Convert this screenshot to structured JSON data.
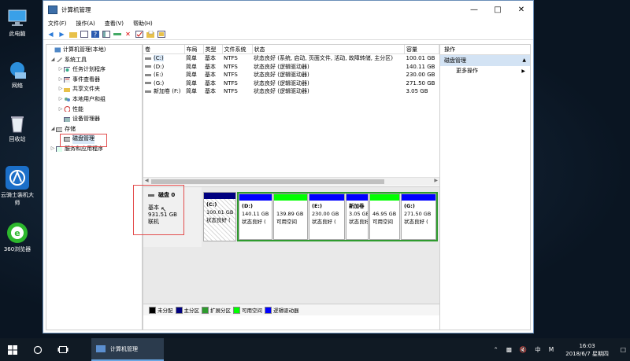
{
  "desktop": {
    "icons": [
      {
        "label": "此电脑"
      },
      {
        "label": "网络"
      },
      {
        "label": "回收站"
      },
      {
        "label": "云骑士装机大师"
      },
      {
        "label": "360浏览器"
      }
    ]
  },
  "window": {
    "title": "计算机管理",
    "menu": [
      "文件(F)",
      "操作(A)",
      "查看(V)",
      "帮助(H)"
    ]
  },
  "tree": {
    "items": [
      {
        "label": "计算机管理(本地)"
      },
      {
        "label": "系统工具"
      },
      {
        "label": "任务计划程序"
      },
      {
        "label": "事件查看器"
      },
      {
        "label": "共享文件夹"
      },
      {
        "label": "本地用户和组"
      },
      {
        "label": "性能"
      },
      {
        "label": "设备管理器"
      },
      {
        "label": "存储"
      },
      {
        "label": "磁盘管理"
      },
      {
        "label": "服务和应用程序"
      }
    ]
  },
  "volumes": {
    "headers": [
      "卷",
      "布局",
      "类型",
      "文件系统",
      "状态",
      "容量"
    ],
    "rows": [
      [
        "(C:)",
        "简单",
        "基本",
        "NTFS",
        "状态良好 (系统, 启动, 页面文件, 活动, 故障转储, 主分区)",
        "100.01 GB"
      ],
      [
        "(D:)",
        "简单",
        "基本",
        "NTFS",
        "状态良好 (逻辑驱动器)",
        "140.11 GB"
      ],
      [
        "(E:)",
        "简单",
        "基本",
        "NTFS",
        "状态良好 (逻辑驱动器)",
        "230.00 GB"
      ],
      [
        "(G:)",
        "简单",
        "基本",
        "NTFS",
        "状态良好 (逻辑驱动器)",
        "271.50 GB"
      ],
      [
        "新加卷 (F:)",
        "简单",
        "基本",
        "NTFS",
        "状态良好 (逻辑驱动器)",
        "3.05 GB"
      ]
    ]
  },
  "disk": {
    "name": "磁盘 0",
    "type": "基本",
    "size": "931.51 GB",
    "status": "联机",
    "partitions": [
      {
        "name": "(C:)",
        "size": "100.01 GB",
        "status": "状态良好 (",
        "color": "#000080"
      },
      {
        "name": "(D:)",
        "size": "140.11 GB",
        "status": "状态良好 (",
        "color": "#0000ff"
      },
      {
        "name": "",
        "size": "139.89 GB",
        "status": "可用空间",
        "color": "#00ff00"
      },
      {
        "name": "(E:)",
        "size": "230.00 GB",
        "status": "状态良好 (",
        "color": "#0000ff"
      },
      {
        "name": "新加卷",
        "size": "3.05 GB",
        "status": "状态良好",
        "color": "#0000ff"
      },
      {
        "name": "",
        "size": "46.95 GB",
        "status": "可用空间",
        "color": "#00ff00"
      },
      {
        "name": "(G:)",
        "size": "271.50 GB",
        "status": "状态良好 (",
        "color": "#0000ff"
      }
    ]
  },
  "legend": [
    {
      "label": "未分配",
      "color": "#000000"
    },
    {
      "label": "主分区",
      "color": "#000080"
    },
    {
      "label": "扩展分区",
      "color": "#2e9b2e"
    },
    {
      "label": "可用空间",
      "color": "#00ff00"
    },
    {
      "label": "逻辑驱动器",
      "color": "#0000ff"
    }
  ],
  "actions": {
    "header": "操作",
    "selected": "磁盘管理",
    "more": "更多操作"
  },
  "taskbar": {
    "task": "计算机管理",
    "ime": "中",
    "ime2": "M",
    "time": "16:03",
    "date": "2018/6/7 星期四"
  }
}
